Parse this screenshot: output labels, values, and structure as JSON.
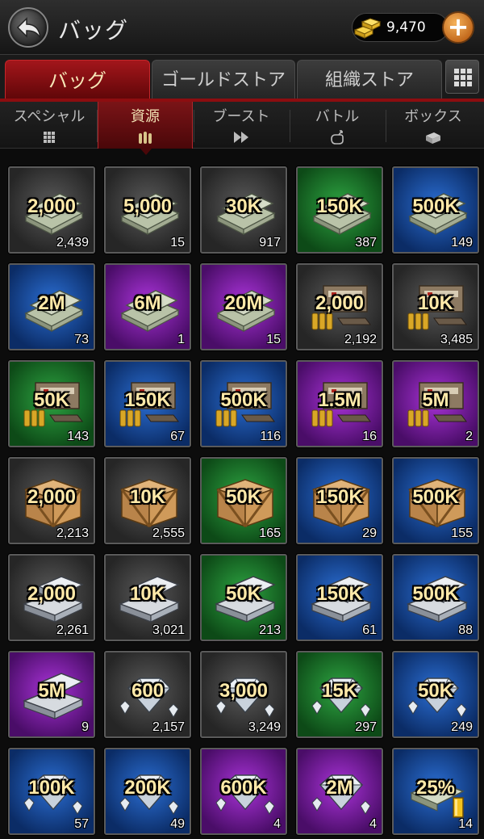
{
  "header": {
    "title": "バッグ",
    "gold_amount": "9,470",
    "plus_label": "+"
  },
  "main_tabs": [
    {
      "label": "バッグ",
      "active": true
    },
    {
      "label": "ゴールドストア",
      "active": false
    },
    {
      "label": "組織ストア",
      "active": false
    }
  ],
  "sub_tabs": [
    {
      "label": "スペシャル",
      "icon": "grid-icon",
      "active": false
    },
    {
      "label": "資源",
      "icon": "ammo-icon",
      "active": true
    },
    {
      "label": "ブースト",
      "icon": "fast-forward-icon",
      "active": false
    },
    {
      "label": "バトル",
      "icon": "fist-icon",
      "active": false
    },
    {
      "label": "ボックス",
      "icon": "box-icon",
      "active": false
    }
  ],
  "colors": {
    "gray": "#3c3c3c",
    "green": "#1f7a2e",
    "blue": "#184c9e",
    "purple": "#7a209e",
    "active_tab": "#8d0d10",
    "amount_text": "#ffe9a8"
  },
  "items": [
    {
      "amount": "2,000",
      "count": "2,439",
      "rarity": "gray",
      "kind": "cash"
    },
    {
      "amount": "5,000",
      "count": "15",
      "rarity": "gray",
      "kind": "cash"
    },
    {
      "amount": "30K",
      "count": "917",
      "rarity": "gray",
      "kind": "cash"
    },
    {
      "amount": "150K",
      "count": "387",
      "rarity": "green",
      "kind": "cash"
    },
    {
      "amount": "500K",
      "count": "149",
      "rarity": "blue",
      "kind": "cash"
    },
    {
      "amount": "2M",
      "count": "73",
      "rarity": "blue",
      "kind": "cash"
    },
    {
      "amount": "6M",
      "count": "1",
      "rarity": "purple",
      "kind": "cash"
    },
    {
      "amount": "20M",
      "count": "15",
      "rarity": "purple",
      "kind": "cash"
    },
    {
      "amount": "2,000",
      "count": "2,192",
      "rarity": "gray",
      "kind": "ammo"
    },
    {
      "amount": "10K",
      "count": "3,485",
      "rarity": "gray",
      "kind": "ammo"
    },
    {
      "amount": "50K",
      "count": "143",
      "rarity": "green",
      "kind": "ammo"
    },
    {
      "amount": "150K",
      "count": "67",
      "rarity": "blue",
      "kind": "ammo"
    },
    {
      "amount": "500K",
      "count": "116",
      "rarity": "blue",
      "kind": "ammo"
    },
    {
      "amount": "1.5M",
      "count": "16",
      "rarity": "purple",
      "kind": "ammo"
    },
    {
      "amount": "5M",
      "count": "2",
      "rarity": "purple",
      "kind": "ammo"
    },
    {
      "amount": "2,000",
      "count": "2,213",
      "rarity": "gray",
      "kind": "crate"
    },
    {
      "amount": "10K",
      "count": "2,555",
      "rarity": "gray",
      "kind": "crate"
    },
    {
      "amount": "50K",
      "count": "165",
      "rarity": "green",
      "kind": "crate"
    },
    {
      "amount": "150K",
      "count": "29",
      "rarity": "blue",
      "kind": "crate"
    },
    {
      "amount": "500K",
      "count": "155",
      "rarity": "blue",
      "kind": "crate"
    },
    {
      "amount": "2,000",
      "count": "2,261",
      "rarity": "gray",
      "kind": "metal"
    },
    {
      "amount": "10K",
      "count": "3,021",
      "rarity": "gray",
      "kind": "metal"
    },
    {
      "amount": "50K",
      "count": "213",
      "rarity": "green",
      "kind": "metal"
    },
    {
      "amount": "150K",
      "count": "61",
      "rarity": "blue",
      "kind": "metal"
    },
    {
      "amount": "500K",
      "count": "88",
      "rarity": "blue",
      "kind": "metal"
    },
    {
      "amount": "5M",
      "count": "9",
      "rarity": "purple",
      "kind": "metal"
    },
    {
      "amount": "600",
      "count": "2,157",
      "rarity": "gray",
      "kind": "diamond"
    },
    {
      "amount": "3,000",
      "count": "3,249",
      "rarity": "gray",
      "kind": "diamond"
    },
    {
      "amount": "15K",
      "count": "297",
      "rarity": "green",
      "kind": "diamond"
    },
    {
      "amount": "50K",
      "count": "249",
      "rarity": "blue",
      "kind": "diamond"
    },
    {
      "amount": "100K",
      "count": "57",
      "rarity": "blue",
      "kind": "diamond"
    },
    {
      "amount": "200K",
      "count": "49",
      "rarity": "blue",
      "kind": "diamond"
    },
    {
      "amount": "600K",
      "count": "4",
      "rarity": "purple",
      "kind": "diamond"
    },
    {
      "amount": "2M",
      "count": "4",
      "rarity": "purple",
      "kind": "diamond"
    },
    {
      "amount": "25%",
      "count": "14",
      "rarity": "blue",
      "kind": "boost-gold"
    }
  ]
}
